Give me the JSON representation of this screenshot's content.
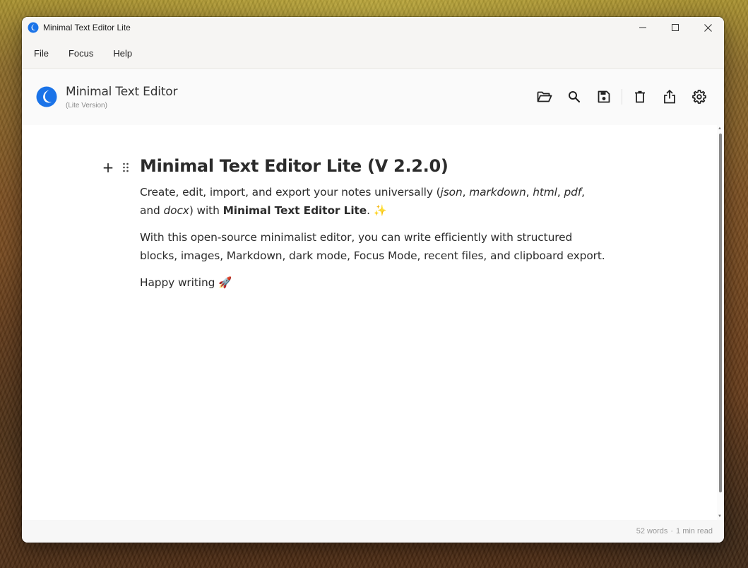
{
  "window": {
    "title": "Minimal Text Editor Lite",
    "controls": [
      "minimize",
      "maximize",
      "close"
    ]
  },
  "menu": {
    "items": [
      {
        "label": "File"
      },
      {
        "label": "Focus"
      },
      {
        "label": "Help"
      }
    ]
  },
  "header": {
    "app_name": "Minimal Text Editor",
    "app_subtitle": "(Lite Version)",
    "toolbar": [
      {
        "name": "open-folder-icon",
        "tooltip": "Open"
      },
      {
        "name": "search-icon",
        "tooltip": "Search"
      },
      {
        "name": "save-icon",
        "tooltip": "Save"
      },
      {
        "name": "delete-icon",
        "tooltip": "Delete"
      },
      {
        "name": "export-icon",
        "tooltip": "Export"
      },
      {
        "name": "settings-icon",
        "tooltip": "Settings"
      }
    ]
  },
  "document": {
    "heading": "Minimal Text Editor Lite (V 2.2.0)",
    "p1": {
      "t1": "Create, edit, import, and export your notes universally (",
      "f1": "json",
      "s1": ", ",
      "f2": "markdown",
      "s2": ", ",
      "f3": "html",
      "s3": ", ",
      "f4": "pdf",
      "s4": ", and ",
      "f5": "docx",
      "t2": ") with ",
      "bold": "Minimal Text Editor Lite",
      "t3": ". ",
      "emoji": "✨"
    },
    "p2": "With this open-source minimalist editor, you can write efficiently with structured blocks, images, Markdown, dark mode, Focus Mode, recent files, and clipboard export.",
    "p3": {
      "text": "Happy writing ",
      "emoji": "🚀"
    }
  },
  "status": {
    "words": "52 words",
    "separator": "·",
    "read_time": "1 min read"
  },
  "colors": {
    "accent": "#1a73e8",
    "text": "#2b2b2b",
    "status_text": "#9a9a9a"
  }
}
